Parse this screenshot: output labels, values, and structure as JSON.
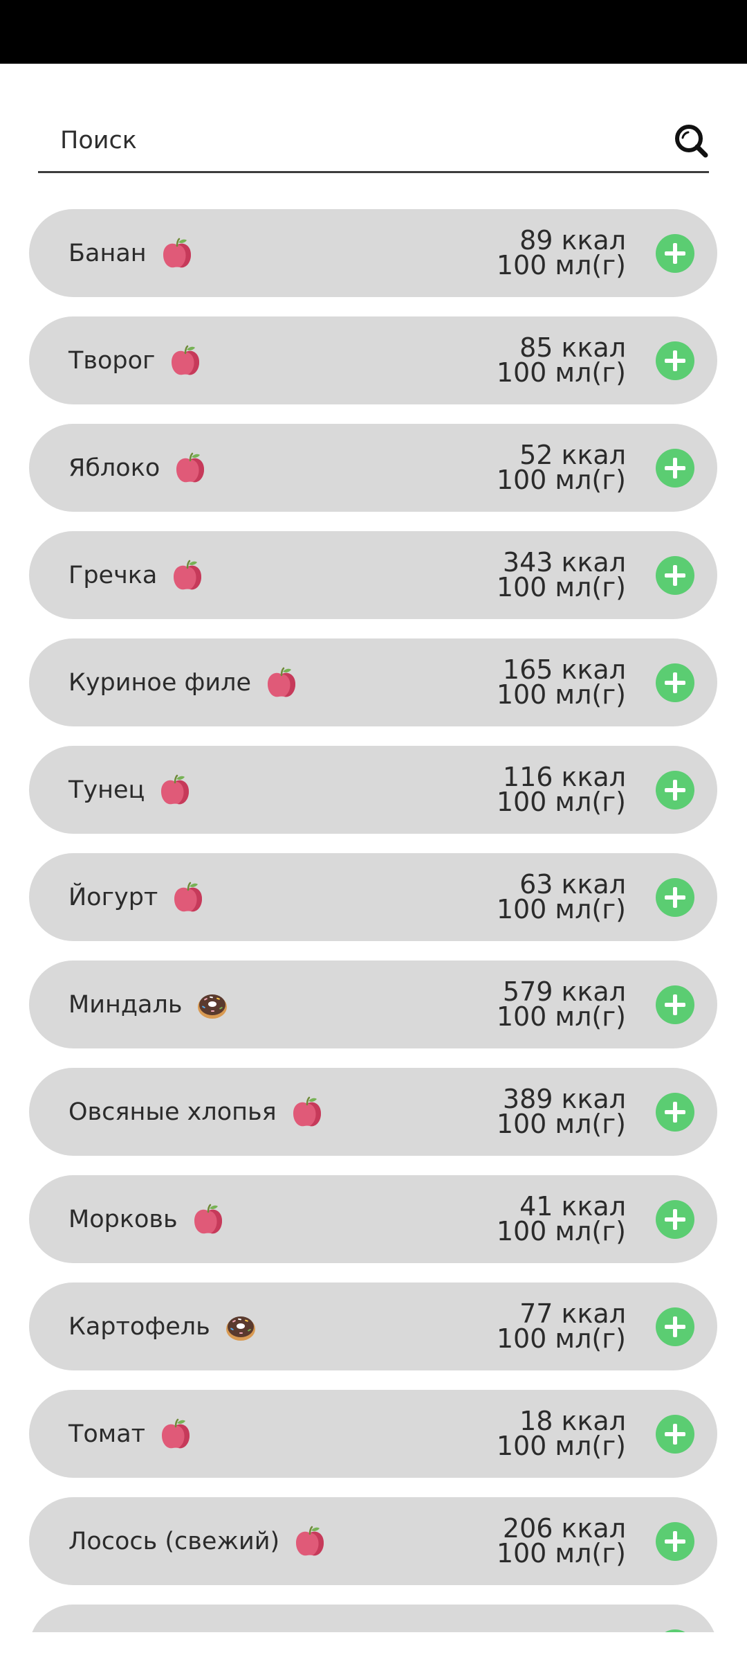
{
  "search": {
    "placeholder": "Поиск",
    "icon": "search-icon"
  },
  "colors": {
    "item_bg": "#d9d9d9",
    "add_button": "#5bcd72",
    "status_bar": "#000000"
  },
  "products": [
    {
      "name": "Банан",
      "kcal": "89 ккал",
      "portion": "100 мл(г)",
      "icon": "apple-icon"
    },
    {
      "name": "Творог",
      "kcal": "85 ккал",
      "portion": "100 мл(г)",
      "icon": "apple-icon"
    },
    {
      "name": "Яблоко",
      "kcal": "52 ккал",
      "portion": "100 мл(г)",
      "icon": "apple-icon"
    },
    {
      "name": "Гречка",
      "kcal": "343 ккал",
      "portion": "100 мл(г)",
      "icon": "apple-icon"
    },
    {
      "name": "Куриное филе",
      "kcal": "165 ккал",
      "portion": "100 мл(г)",
      "icon": "apple-icon"
    },
    {
      "name": "Тунец",
      "kcal": "116 ккал",
      "portion": "100 мл(г)",
      "icon": "apple-icon"
    },
    {
      "name": "Йогурт",
      "kcal": "63 ккал",
      "portion": "100 мл(г)",
      "icon": "apple-icon"
    },
    {
      "name": "Миндаль",
      "kcal": "579 ккал",
      "portion": "100 мл(г)",
      "icon": "donut-icon"
    },
    {
      "name": "Овсяные хлопья",
      "kcal": "389 ккал",
      "portion": "100 мл(г)",
      "icon": "apple-icon"
    },
    {
      "name": "Морковь",
      "kcal": "41 ккал",
      "portion": "100 мл(г)",
      "icon": "apple-icon"
    },
    {
      "name": "Картофель",
      "kcal": "77 ккал",
      "portion": "100 мл(г)",
      "icon": "donut-icon"
    },
    {
      "name": "Томат",
      "kcal": "18 ккал",
      "portion": "100 мл(г)",
      "icon": "apple-icon"
    },
    {
      "name": "Лосось (свежий)",
      "kcal": "206 ккал",
      "portion": "100 мл(г)",
      "icon": "apple-icon"
    },
    {
      "name": "",
      "kcal": "",
      "portion": "",
      "icon": ""
    }
  ]
}
